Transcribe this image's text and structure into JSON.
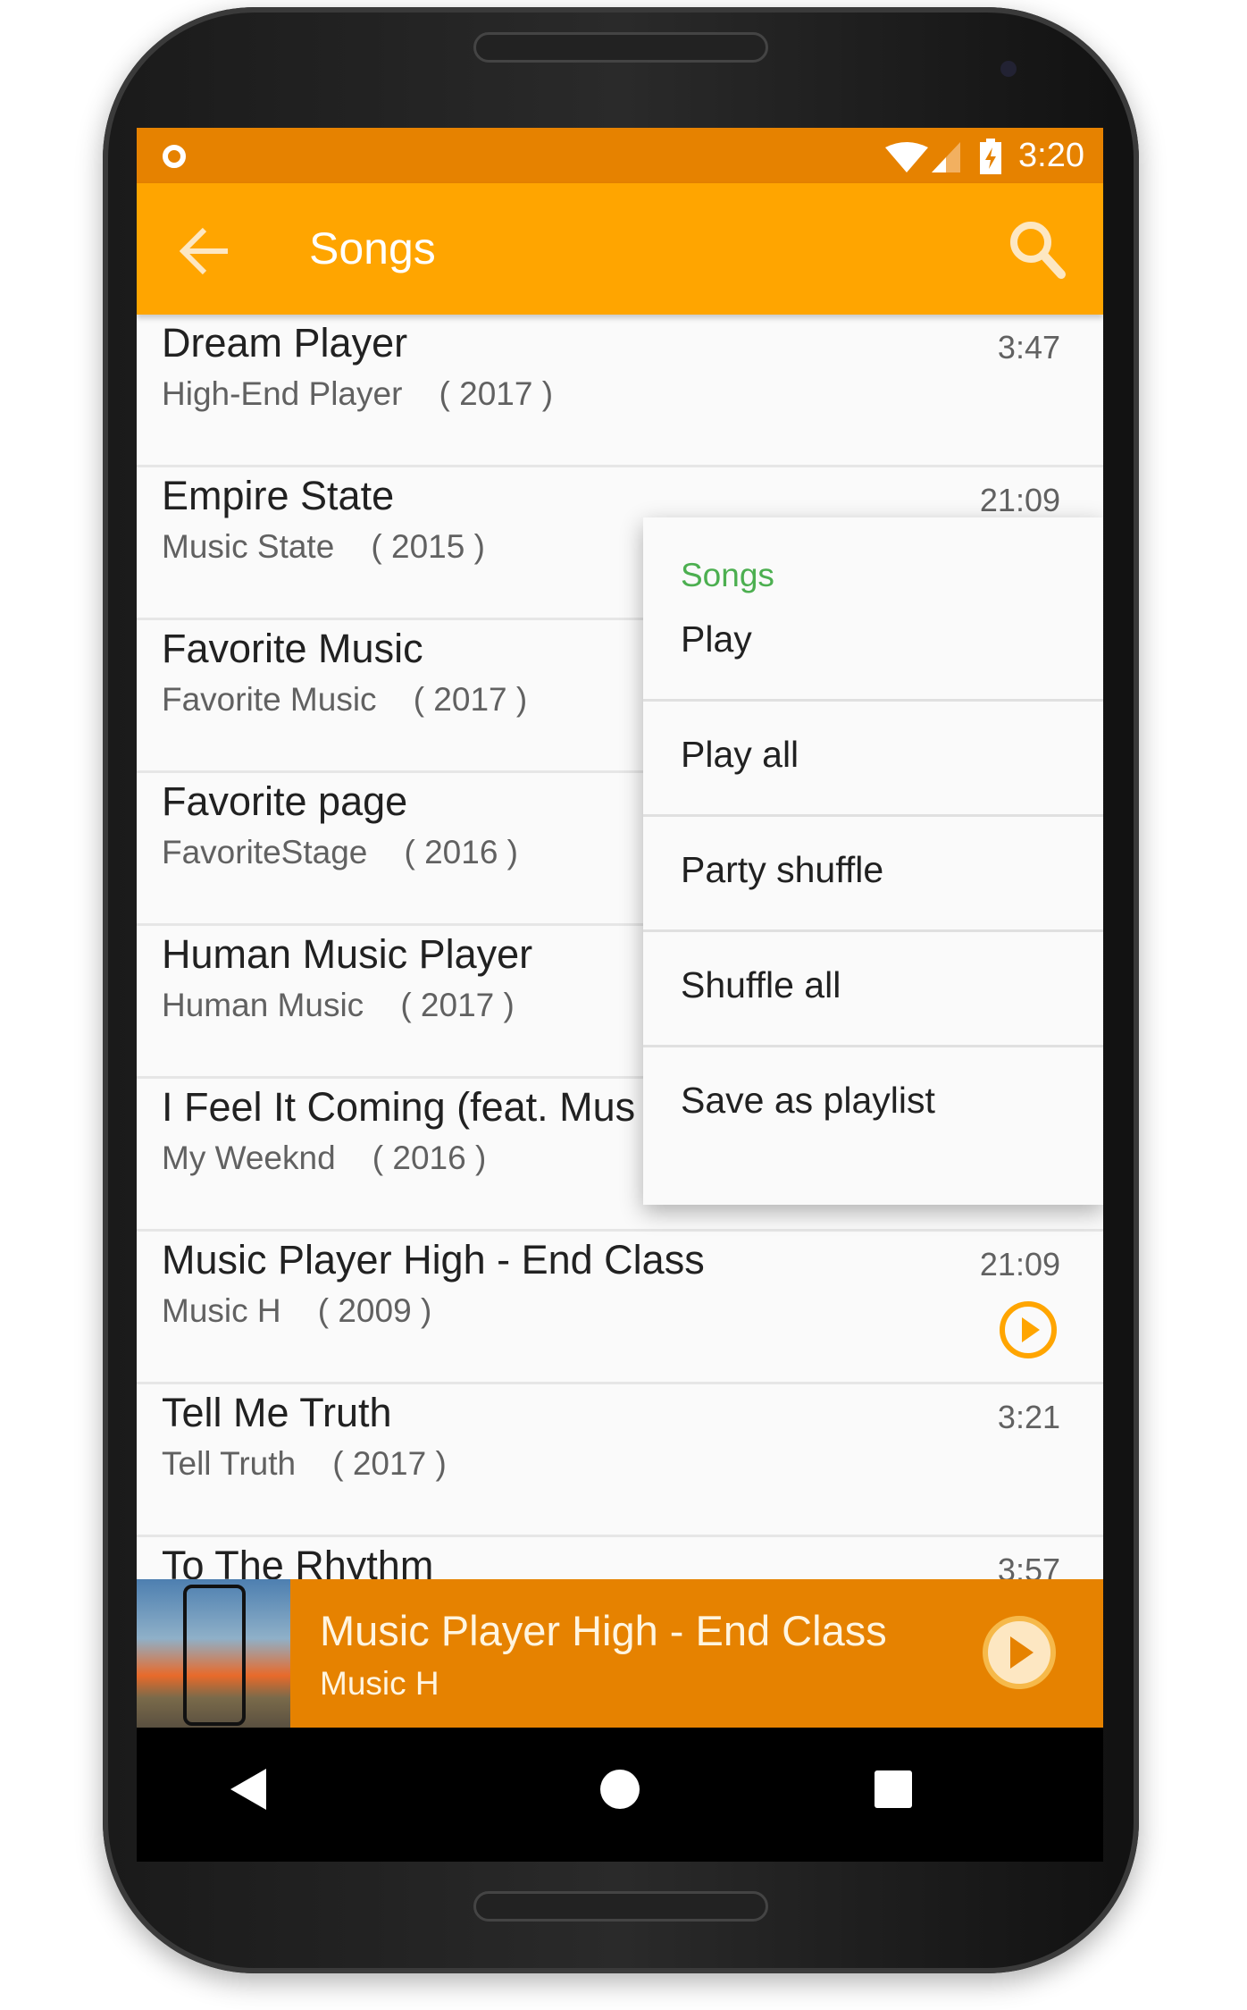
{
  "status_bar": {
    "time": "3:20",
    "icons": [
      "notification-dot-icon",
      "wifi-icon",
      "signal-icon",
      "battery-charging-icon"
    ]
  },
  "toolbar": {
    "title": "Songs",
    "back_icon": "arrow-left-icon",
    "search_icon": "search-icon"
  },
  "songs": [
    {
      "title": "Dream Player",
      "artist": "High-End Player",
      "year": "( 2017 )",
      "duration": "3:47"
    },
    {
      "title": "Empire State",
      "artist": "Music State",
      "year": "( 2015 )",
      "duration": "21:09"
    },
    {
      "title": "Favorite Music",
      "artist": "Favorite Music",
      "year": "( 2017 )",
      "duration": ""
    },
    {
      "title": "Favorite page",
      "artist": "FavoriteStage",
      "year": "( 2016 )",
      "duration": ""
    },
    {
      "title": "Human Music Player",
      "artist": "Human Music",
      "year": "( 2017 )",
      "duration": ""
    },
    {
      "title": "I Feel It Coming (feat. Mus",
      "artist": "My Weeknd",
      "year": "( 2016 )",
      "duration": ""
    },
    {
      "title": "Music Player High - End Class",
      "artist": "Music H",
      "year": "( 2009 )",
      "duration": "21:09",
      "playing": true
    },
    {
      "title": "Tell Me Truth",
      "artist": "Tell Truth",
      "year": "( 2017 )",
      "duration": "3:21"
    },
    {
      "title": "To The Rhythm",
      "artist": "",
      "year": "",
      "duration": "3:57"
    }
  ],
  "menu": {
    "header": "Songs",
    "items": [
      "Play",
      "Play all",
      "Party shuffle",
      "Shuffle all",
      "Save as playlist"
    ]
  },
  "now_playing": {
    "title": "Music Player High - End Class",
    "artist": "Music H"
  },
  "colors": {
    "accent": "#ffa500",
    "status": "#e68200",
    "menu_header": "#4caf50"
  }
}
